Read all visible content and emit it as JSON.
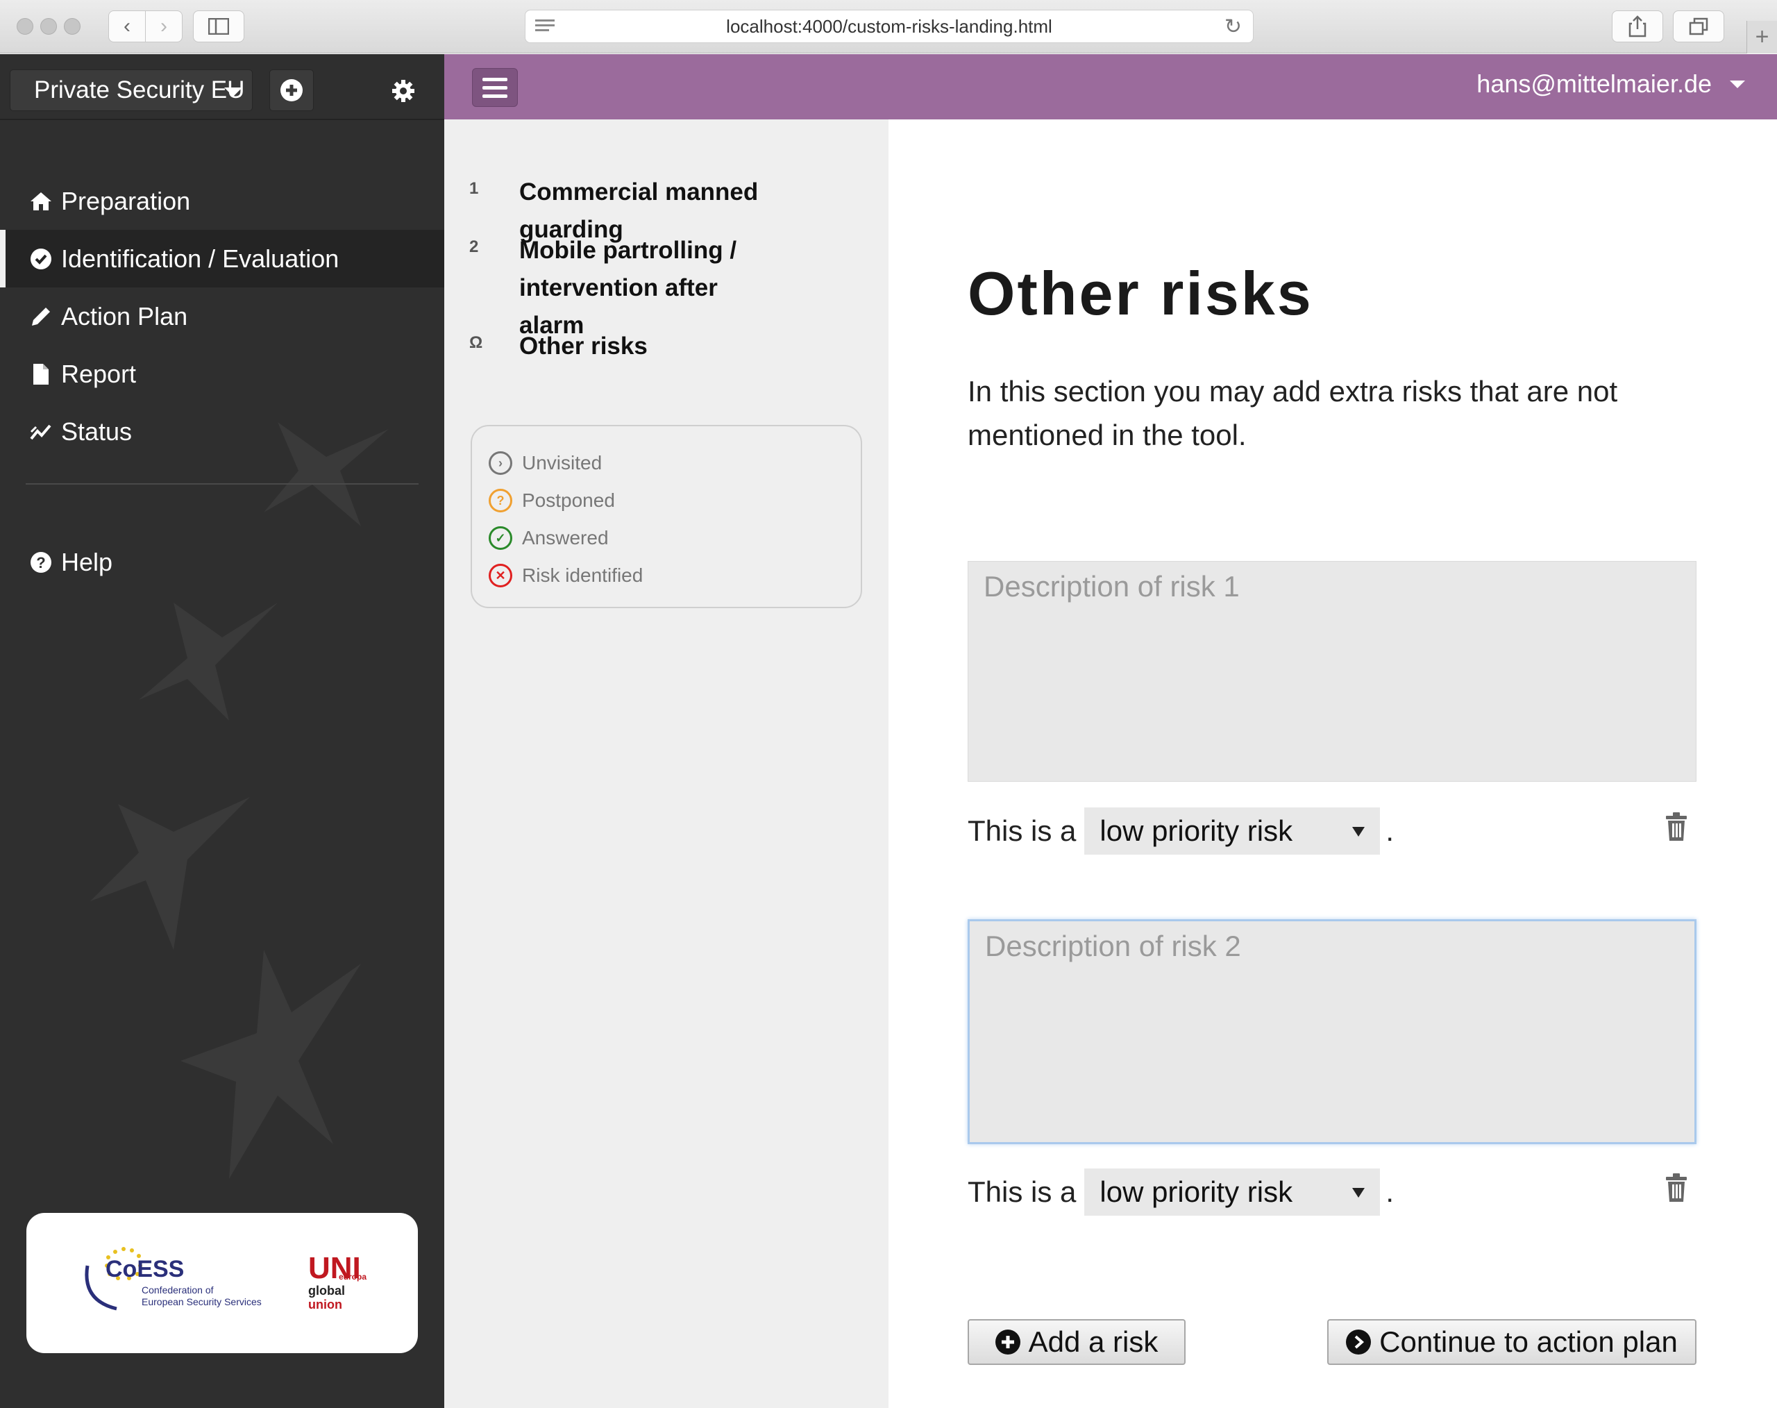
{
  "browser": {
    "url": "localhost:4000/custom-risks-landing.html"
  },
  "sidebar": {
    "tool_selector": "Private Security EU",
    "nav": [
      {
        "label": "Preparation",
        "icon": "home-icon"
      },
      {
        "label": "Identification / Evaluation",
        "icon": "check-circle-icon",
        "active": true
      },
      {
        "label": "Action Plan",
        "icon": "pencil-icon"
      },
      {
        "label": "Report",
        "icon": "document-icon"
      },
      {
        "label": "Status",
        "icon": "chart-line-icon"
      }
    ],
    "help": {
      "label": "Help",
      "icon": "question-circle-icon"
    },
    "logos": {
      "coess_name": "CoESS",
      "coess_line1": "Confederation of",
      "coess_line2": "European Security Services",
      "uni_top": "UNI",
      "uni_europa": "europa",
      "uni_global": "global",
      "uni_union": "union"
    }
  },
  "topbar": {
    "user": "hans@mittelmaier.de"
  },
  "toc": {
    "items": [
      {
        "number": "1",
        "label": "Commercial manned guarding"
      },
      {
        "number": "2",
        "label": "Mobile partrolling / intervention after alarm"
      },
      {
        "number": "Ω",
        "label": "Other risks"
      }
    ]
  },
  "legend": {
    "items": [
      {
        "label": "Unvisited",
        "color": "#777777",
        "symbol": "›"
      },
      {
        "label": "Postponed",
        "color": "#f0a030",
        "symbol": "?"
      },
      {
        "label": "Answered",
        "color": "#2a8a2a",
        "symbol": "✓"
      },
      {
        "label": "Risk identified",
        "color": "#e02020",
        "symbol": "✕"
      }
    ]
  },
  "main": {
    "title": "Other risks",
    "intro": "In this section you may add extra risks that are not mentioned in the tool.",
    "risks": [
      {
        "placeholder": "Description of risk 1",
        "prefix": "This is a",
        "priority": "low priority risk",
        "suffix": "."
      },
      {
        "placeholder": "Description of risk 2",
        "prefix": "This is a",
        "priority": "low priority risk",
        "suffix": "."
      }
    ],
    "add_button": "Add a risk",
    "continue_button": "Continue to action plan"
  },
  "colors": {
    "accent_purple": "#9b6b9c",
    "sidebar_bg": "#2f2f2f",
    "focus_border": "#a9c9ec"
  }
}
